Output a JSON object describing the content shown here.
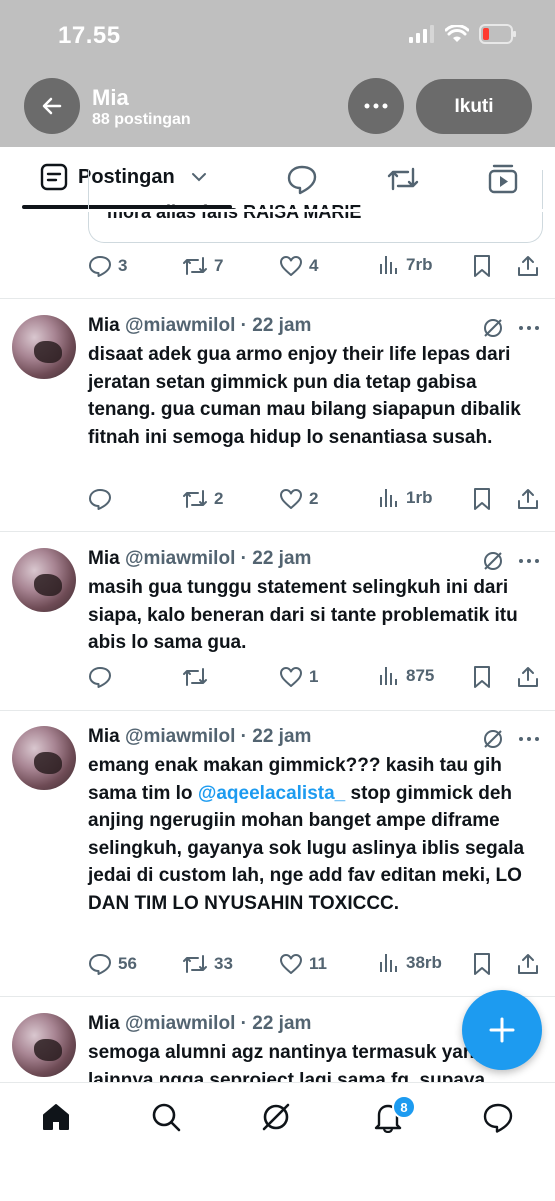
{
  "status_bar": {
    "time": "17.55"
  },
  "header": {
    "name": "Mia",
    "post_count": "88 postingan",
    "follow_label": "Ikuti"
  },
  "tabs": {
    "posts_label": "Postingan"
  },
  "partial_top": {
    "quoted_text": "mora alias fans RAISA MARIE",
    "replies": "3",
    "reposts": "7",
    "likes": "4",
    "views": "7rb"
  },
  "tweets": [
    {
      "name": "Mia",
      "handle": "@miawmilol",
      "time": "· 22 jam",
      "text": "disaat adek gua armo enjoy their life lepas dari jeratan setan gimmick pun dia tetap gabisa tenang. gua cuman mau bilang siapapun dibalik fitnah ini semoga hidup lo senantiasa susah.",
      "replies": "",
      "reposts": "2",
      "likes": "2",
      "views": "1rb"
    },
    {
      "name": "Mia",
      "handle": "@miawmilol",
      "time": "· 22 jam",
      "text": "masih gua tunggu statement selingkuh ini dari siapa, kalo beneran dari si tante problematik itu abis lo sama gua.",
      "replies": "",
      "reposts": "",
      "likes": "1",
      "views": "875"
    },
    {
      "name": "Mia",
      "handle": "@miawmilol",
      "time": "· 22 jam",
      "text_before": "emang enak makan gimmick??? kasih tau gih sama tim lo ",
      "mention": "@aqeelacalista_",
      "text_after": " stop gimmick deh anjing ngerugiin mohan banget ampe diframe selingkuh, gayanya sok lugu aslinya iblis segala jedai di custom lah, nge add fav editan meki, LO DAN TIM LO NYUSAHIN TOXICCC.",
      "replies": "56",
      "reposts": "33",
      "likes": "11",
      "views": "38rb"
    },
    {
      "name": "Mia",
      "handle": "@miawmilol",
      "time": "· 22 jam",
      "text": "semoga alumni agz nantinya termasuk yang lainnya ngga seproject lagi sama fg, supaya"
    }
  ],
  "bottom_nav": {
    "notification_count": "8"
  },
  "colors": {
    "accent": "#1d9bf0",
    "text": "#0f1419",
    "muted": "#536471",
    "header_bg": "#bfbfbf"
  }
}
